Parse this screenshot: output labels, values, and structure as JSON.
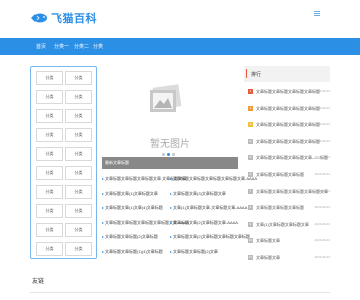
{
  "header": {
    "logo_text": "飞猫百科"
  },
  "nav": {
    "items": [
      "首页",
      "分类一",
      "分类二",
      "分类"
    ]
  },
  "sidebar": {
    "cells": [
      "分类",
      "分类",
      "分类",
      "分类",
      "分类",
      "分类",
      "分类",
      "分类",
      "分类",
      "分类",
      "分类",
      "分类",
      "分类",
      "分类",
      "分类",
      "分类",
      "分类",
      "分类",
      "分类",
      "分类"
    ]
  },
  "slider": {
    "placeholder_text": "暂无图片",
    "caption": "最新文章标题",
    "active_dot": 1
  },
  "articles": {
    "left": [
      "文章标题文章标题文章标题文章 文章标题文章",
      "文章标题文章(1)文章标题文章",
      "文章标题文章(1)文章(4)文章标题",
      "文章标题文章标题文章标题文章标题文章-AAAA",
      "文章标题文章标题(2)文章标题",
      "文章标题文章标题(1)(4)文章标题"
    ],
    "right": [
      "文章标题文章标题文章标题文章标题文章-AAAA",
      "文章标题文章(3)文章标题文章",
      "文章(1)文章标题文章-文章标题文章-AAAA",
      "文章标题文章(2)文章标题文章-AAAA",
      "文章标题文章(2)文章标题文章标题文章标题",
      "文章标题文章标题(2)文章"
    ]
  },
  "ranking": {
    "title": "排行",
    "items": [
      {
        "num": "1",
        "title": "文章标题文章标题文章标题文章标题",
        "date": "2023-06-01",
        "color": "#e65a3c"
      },
      {
        "num": "2",
        "title": "文章标题文章标题文章标题文章标题",
        "date": "2023-06-01",
        "color": "#f09a37"
      },
      {
        "num": "3",
        "title": "文章标题文章标题文章标题文章标题",
        "date": "2023-06-01",
        "color": "#f2c03d"
      },
      {
        "num": "4",
        "title": "文章标题文章标题文章标题文章标题",
        "date": "2023-06-01",
        "color": "#bbbbbb"
      },
      {
        "num": "5",
        "title": "文章标题文章标题文章标题文章——标题",
        "date": "2023-06-01",
        "color": "#bbbbbb"
      },
      {
        "num": "6",
        "title": "文章标题文章标题文章标题",
        "date": "2023-06-01",
        "color": "#bbbbbb"
      },
      {
        "num": "7",
        "title": "文章标题文章标题文章标题文章标题文章",
        "date": "2023-06-01",
        "color": "#bbbbbb"
      },
      {
        "num": "8",
        "title": "文章标题文章标题文章标题",
        "date": "2023-06-01",
        "color": "#bbbbbb"
      },
      {
        "num": "9",
        "title": "文章(1)文章标题文章标题文章",
        "date": "2023-06-01",
        "color": "#bbbbbb"
      },
      {
        "num": "10",
        "title": "文章标题文章",
        "date": "2023-06-01",
        "color": "#bbbbbb"
      },
      {
        "num": "11",
        "title": "文章标题文章",
        "date": "2023-06-01",
        "color": "#bbbbbb"
      }
    ]
  },
  "footer": {
    "title": "友链"
  },
  "colors": {
    "primary": "#2b8fe6",
    "rank_top": "#e65a3c"
  }
}
